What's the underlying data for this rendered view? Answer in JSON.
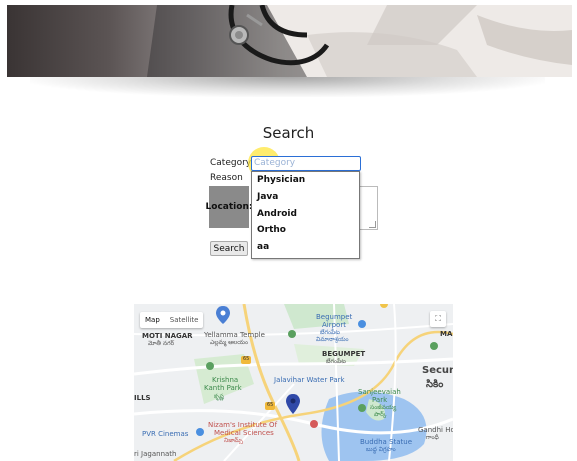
{
  "page": {
    "title": "Search"
  },
  "form": {
    "category_label": "Category",
    "category_placeholder": "Category",
    "reason_label": "Reason",
    "location_label": "Location:",
    "search_button": "Search"
  },
  "dropdown": {
    "options": [
      "Physician",
      "Java",
      "Android",
      "Ortho",
      "aa"
    ]
  },
  "map": {
    "controls": {
      "map": "Map",
      "satellite": "Satellite"
    },
    "labels": {
      "moti_nagar": "MOTI NAGAR",
      "moti_nagar_te": "మోతీ నగర్",
      "yellamma": "Yellamma Temple",
      "yellamma_te": "ఎల్లమ్మ ఆలయం",
      "begumpet_airport": "Begumpet",
      "begumpet_airport2": "Airport",
      "begumpet_airport_te": "బేగంపేట",
      "begumpet_airport_te2": "విమానాశ్రయం",
      "begumpet": "BEGUMPET",
      "begumpet_te": "బేగంపేట",
      "krishna": "Krishna",
      "kanth_park": "Kanth Park",
      "krishna_te": "కృష్ణ",
      "jalavihar": "Jalavihar Water Park",
      "sanjeevaiah": "Sanjeevaiah",
      "sanjeevaiah_park": "Park",
      "sanjeevaiah_te": "సంజీవయ్య",
      "sanjeevaiah_te2": "పార్క్",
      "secur": "Secur",
      "secur_te": "సికిం",
      "ma": "MA",
      "hills": "ILLS",
      "nizam": "Nizam's Institute Of",
      "nizam2": "Medical Sciences",
      "nizam_te": "నిజామ్స్",
      "pvr": "PVR Cinemas",
      "gandhi": "Gandhi Ho",
      "gandhi_te": "గాంధీ",
      "buddha": "Buddha Statue",
      "buddha_te": "బుద్ధ విగ్రహం",
      "jagannath": "ri Jagannath",
      "road_65a": "65",
      "road_65b": "65"
    }
  }
}
